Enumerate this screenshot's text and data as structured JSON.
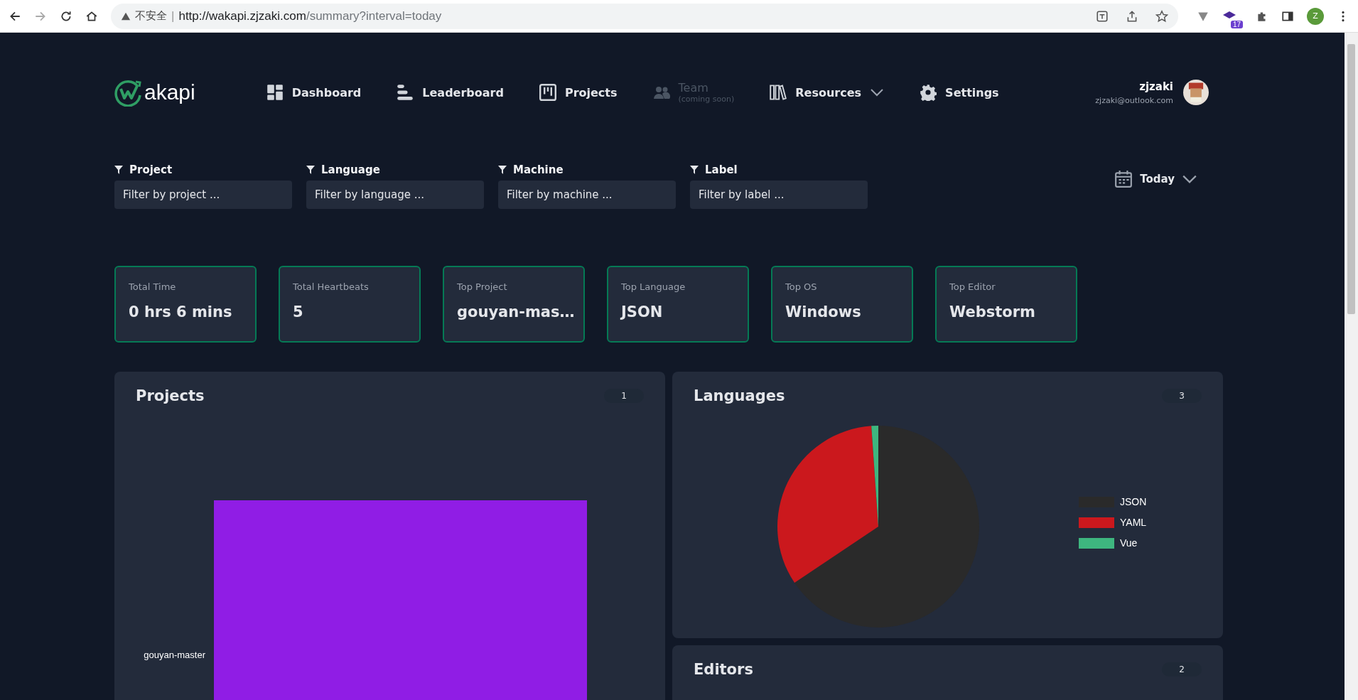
{
  "browser": {
    "security": "不安全",
    "separator": "|",
    "url_host": "http://wakapi.zjzaki.com",
    "url_path": "/summary?interval=today",
    "extension_badge": "17",
    "profile_initial": "Z"
  },
  "logo": {
    "text": "akapi"
  },
  "nav": [
    {
      "label": "Dashboard",
      "kind": "dashboard",
      "disabled": false
    },
    {
      "label": "Leaderboard",
      "kind": "leaderboard",
      "disabled": false
    },
    {
      "label": "Projects",
      "kind": "projects",
      "disabled": false
    },
    {
      "label": "Team",
      "sublabel": "(coming soon)",
      "kind": "team",
      "disabled": true
    },
    {
      "label": "Resources",
      "kind": "resources",
      "disabled": false,
      "dropdown": true
    },
    {
      "label": "Settings",
      "kind": "settings",
      "disabled": false
    }
  ],
  "user": {
    "name": "zjzaki",
    "email": "zjzaki@outlook.com"
  },
  "filters": [
    {
      "label": "Project",
      "placeholder": "Filter by project ..."
    },
    {
      "label": "Language",
      "placeholder": "Filter by language ..."
    },
    {
      "label": "Machine",
      "placeholder": "Filter by machine ..."
    },
    {
      "label": "Label",
      "placeholder": "Filter by label ..."
    }
  ],
  "interval": {
    "label": "Today"
  },
  "stats": [
    {
      "label": "Total Time",
      "value": "0 hrs 6 mins"
    },
    {
      "label": "Total Heartbeats",
      "value": "5"
    },
    {
      "label": "Top Project",
      "value": "gouyan-mas…"
    },
    {
      "label": "Top Language",
      "value": "JSON"
    },
    {
      "label": "Top OS",
      "value": "Windows"
    },
    {
      "label": "Top Editor",
      "value": "Webstorm"
    }
  ],
  "projects": {
    "title": "Projects",
    "count": "1",
    "bars": [
      {
        "label": "gouyan-master",
        "color": "#901de5"
      }
    ]
  },
  "languages": {
    "title": "Languages",
    "count": "3",
    "chart_data": {
      "type": "pie",
      "legend": "right",
      "categories": [
        "JSON",
        "YAML",
        "Vue"
      ],
      "series": [
        {
          "values": [
            65.6,
            33.3,
            1.1
          ],
          "colors": [
            "#2a2a2a",
            "#cb181d",
            "#3eb67f"
          ]
        }
      ]
    }
  },
  "editors": {
    "title": "Editors",
    "count": "2"
  }
}
